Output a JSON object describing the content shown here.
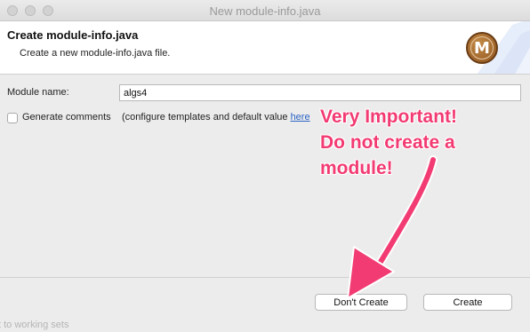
{
  "window": {
    "title": "New module-info.java"
  },
  "header": {
    "title": "Create module-info.java",
    "description": "Create a new module-info.java file.",
    "logo_letter": "M"
  },
  "form": {
    "module_name_label": "Module name:",
    "module_name_value": "algs4",
    "generate_comments_label": "Generate comments",
    "generate_comments_checked": false,
    "config_text": "(configure templates and default value ",
    "config_link": "here"
  },
  "buttons": {
    "dont_create": "Don't Create",
    "create": "Create"
  },
  "background_text": "t to working sets",
  "annotation": {
    "line1": "Very Important!",
    "line2": "Do not create a",
    "line3": "module!",
    "color": "#f23b72"
  },
  "icons": [
    "maven-logo-icon",
    "annotation-arrow-icon"
  ]
}
